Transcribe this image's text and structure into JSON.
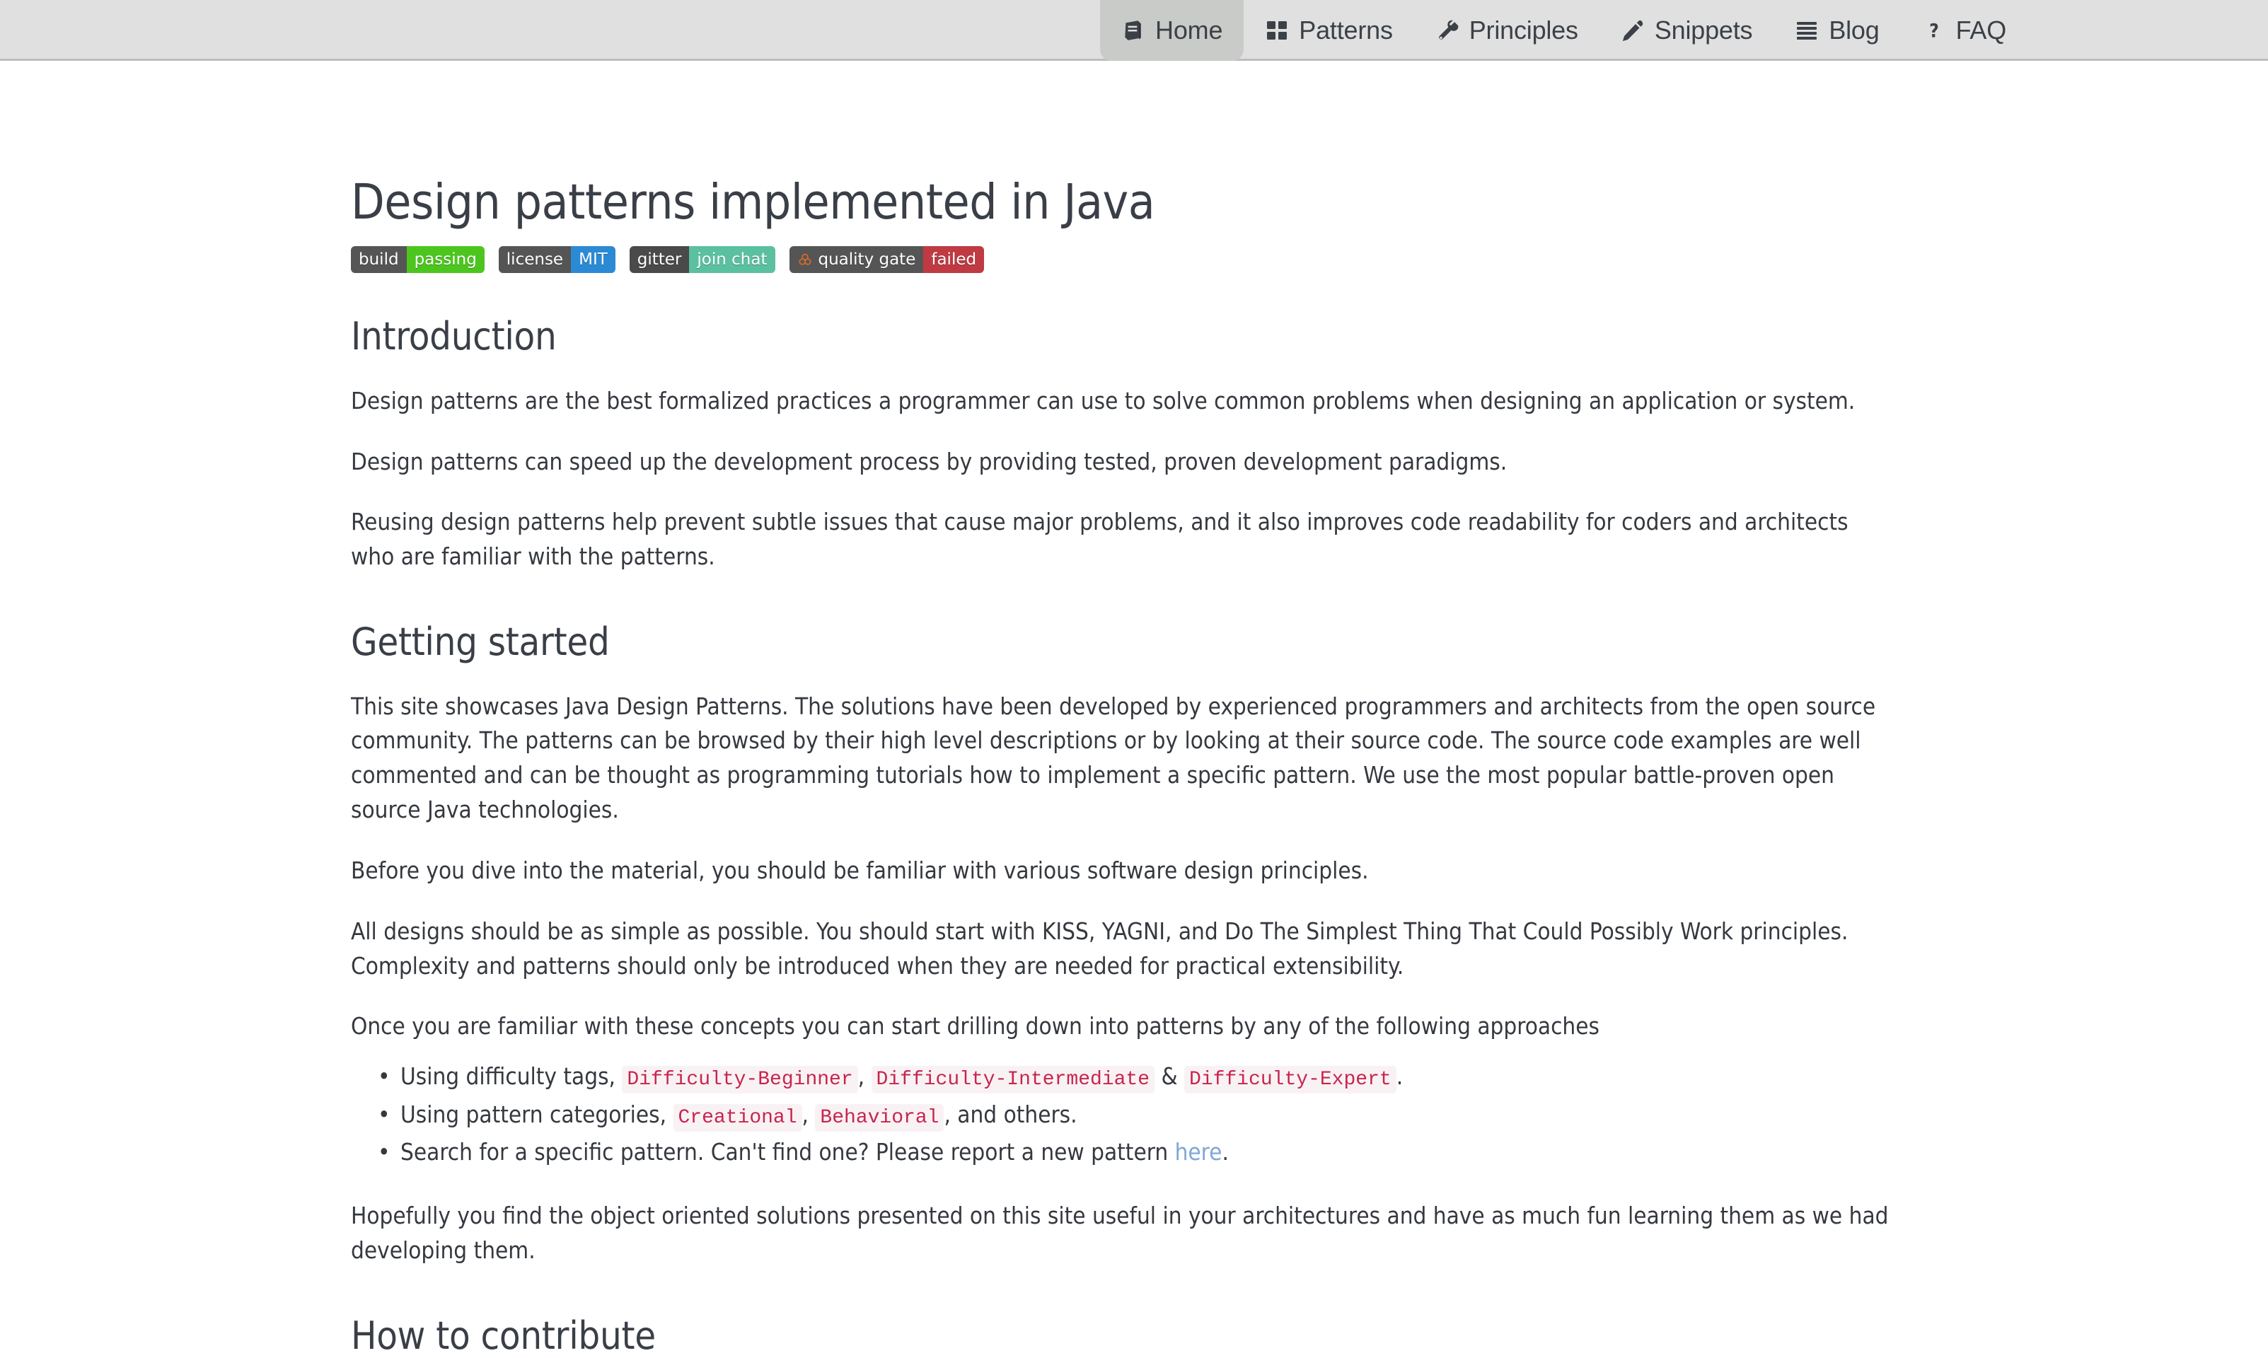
{
  "nav": {
    "items": [
      {
        "label": "Home",
        "icon": "book-icon",
        "active": true
      },
      {
        "label": "Patterns",
        "icon": "grid-icon",
        "active": false
      },
      {
        "label": "Principles",
        "icon": "wrench-icon",
        "active": false
      },
      {
        "label": "Snippets",
        "icon": "pencil-icon",
        "active": false
      },
      {
        "label": "Blog",
        "icon": "list-lines-icon",
        "active": false
      },
      {
        "label": "FAQ",
        "icon": "question-icon",
        "active": false
      }
    ]
  },
  "page": {
    "title": "Design patterns implemented in Java"
  },
  "badges": [
    {
      "name": "build-badge",
      "left": "build",
      "right": "passing",
      "left_color": "#555555",
      "right_color": "#4cc61e",
      "icon": null
    },
    {
      "name": "license-badge",
      "left": "license",
      "right": "MIT",
      "left_color": "#555555",
      "right_color": "#2b8ad4",
      "icon": null
    },
    {
      "name": "gitter-badge",
      "left": "gitter",
      "right": "join chat",
      "left_color": "#4a4a4a",
      "right_color": "#5bc0a0",
      "icon": null
    },
    {
      "name": "quality-gate-badge",
      "left": "quality gate",
      "right": "failed",
      "left_color": "#555555",
      "right_color": "#bf3a42",
      "icon": "sonarqube-icon"
    }
  ],
  "sections": {
    "introduction": {
      "heading": "Introduction",
      "paragraphs": [
        "Design patterns are the best formalized practices a programmer can use to solve common problems when designing an application or system.",
        "Design patterns can speed up the development process by providing tested, proven development paradigms.",
        "Reusing design patterns help prevent subtle issues that cause major problems, and it also improves code readability for coders and architects who are familiar with the patterns."
      ]
    },
    "getting_started": {
      "heading": "Getting started",
      "paragraphs": [
        "This site showcases Java Design Patterns. The solutions have been developed by experienced programmers and architects from the open source community. The patterns can be browsed by their high level descriptions or by looking at their source code. The source code examples are well commented and can be thought as programming tutorials how to implement a specific pattern. We use the most popular battle-proven open source Java technologies.",
        "Before you dive into the material, you should be familiar with various software design principles.",
        "All designs should be as simple as possible. You should start with KISS, YAGNI, and Do The Simplest Thing That Could Possibly Work principles. Complexity and patterns should only be introduced when they are needed for practical extensibility.",
        "Once you are familiar with these concepts you can start drilling down into patterns by any of the following approaches"
      ],
      "list": {
        "item1": {
          "prefix": "Using difficulty tags,",
          "code1": "Difficulty-Beginner",
          "sep1": ",",
          "code2": "Difficulty-Intermediate",
          "sep2": "&",
          "code3": "Difficulty-Expert",
          "suffix": "."
        },
        "item2": {
          "prefix": "Using pattern categories,",
          "code1": "Creational",
          "sep1": ",",
          "code2": "Behavioral",
          "suffix": ", and others."
        },
        "item3": {
          "prefix": "Search for a specific pattern. Can't find one? Please report a new pattern",
          "link": "here",
          "suffix": "."
        }
      },
      "closing": "Hopefully you find the object oriented solutions presented on this site useful in your architectures and have as much fun learning them as we had developing them."
    },
    "how_to_contribute": {
      "heading": "How to contribute"
    }
  }
}
